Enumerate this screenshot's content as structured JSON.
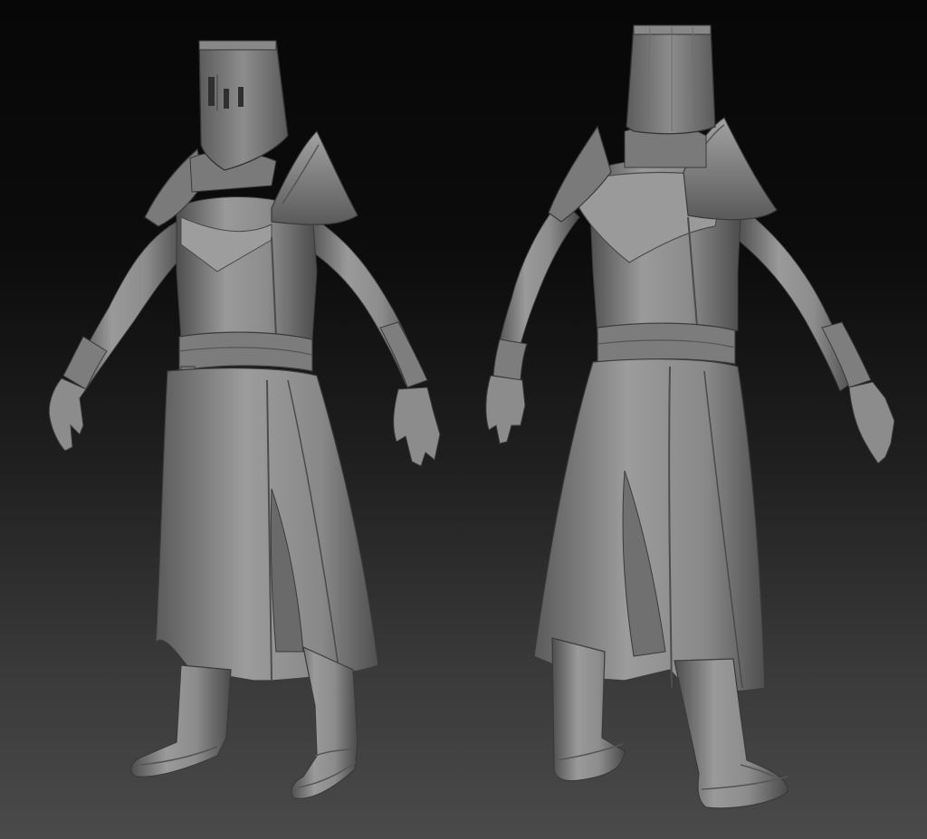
{
  "scene": {
    "subject": "knight-sculpt",
    "views": [
      {
        "id": "front-three-quarter"
      },
      {
        "id": "back-three-quarter"
      }
    ],
    "colors": {
      "background_top": "#070707",
      "background_bottom": "#4a4a4a",
      "clay": "#8a8a8a",
      "clay_highlight": "#a9a9a9",
      "clay_shadow": "#4c4c4c"
    }
  }
}
